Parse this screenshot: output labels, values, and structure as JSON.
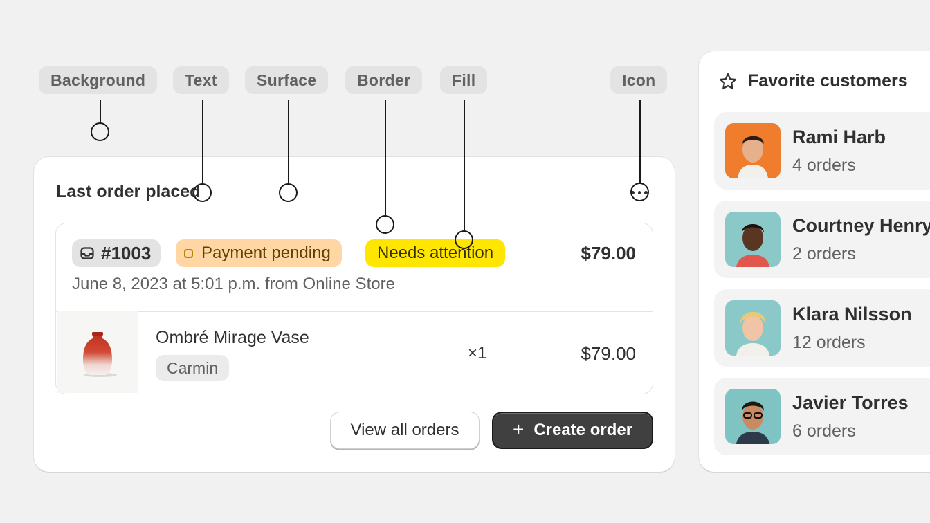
{
  "tags": {
    "background": "Background",
    "text": "Text",
    "surface": "Surface",
    "border": "Border",
    "fill": "Fill",
    "icon": "Icon"
  },
  "card": {
    "title": "Last order placed",
    "order_number": "#1003",
    "payment_status": "Payment pending",
    "attention_status": "Needs attention",
    "total": "$79.00",
    "date": "June 8, 2023 at 5:01 p.m. from Online Store",
    "product": {
      "name": "Ombré Mirage Vase",
      "variant": "Carmin",
      "quantity": "×1",
      "price": "$79.00"
    },
    "view_all_label": "View all orders",
    "create_label": "Create order"
  },
  "favorites": {
    "title": "Favorite customers",
    "customers": [
      {
        "name": "Rami Harb",
        "orders": "4 orders",
        "avatar_bg": "#f07c2e"
      },
      {
        "name": "Courtney Henry",
        "orders": "2 orders",
        "avatar_bg": "#8bc9c9"
      },
      {
        "name": "Klara Nilsson",
        "orders": "12 orders",
        "avatar_bg": "#8bc9c9"
      },
      {
        "name": "Javier Torres",
        "orders": "6 orders",
        "avatar_bg": "#7fc3c3"
      }
    ]
  },
  "colors": {
    "page_bg": "#f1f1f1",
    "payment_badge_bg": "#ffd6a4",
    "attention_badge_bg": "#ffe600",
    "primary_button_bg": "#404040"
  },
  "icons": {
    "order_badge": "inbox-icon",
    "payment_badge": "circle-outline-icon",
    "more": "more-horizontal-icon",
    "favorites": "star-icon",
    "create": "plus-icon"
  }
}
